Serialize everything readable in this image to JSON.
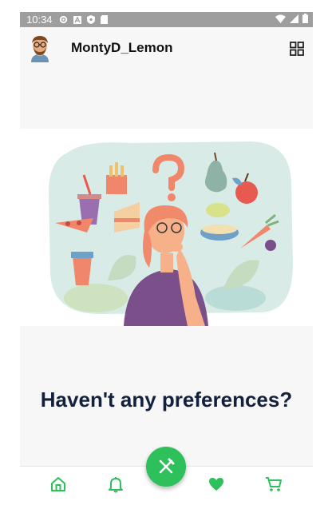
{
  "status_bar": {
    "time": "10:34",
    "left_icons": [
      "settings-icon",
      "a-icon",
      "shield-icon",
      "sd-card-icon"
    ],
    "right_icons": [
      "wifi-icon",
      "signal-icon",
      "battery-icon"
    ]
  },
  "header": {
    "username": "MontyD_Lemon",
    "avatar_icon": "avatar-icon",
    "menu_icon": "grid-icon"
  },
  "main": {
    "headline": "Haven't any preferences?"
  },
  "bottom_nav": {
    "items": [
      "home-icon",
      "bell-icon",
      "fork-knife-icon",
      "heart-icon",
      "cart-icon"
    ],
    "accent": "#2ec05a"
  }
}
